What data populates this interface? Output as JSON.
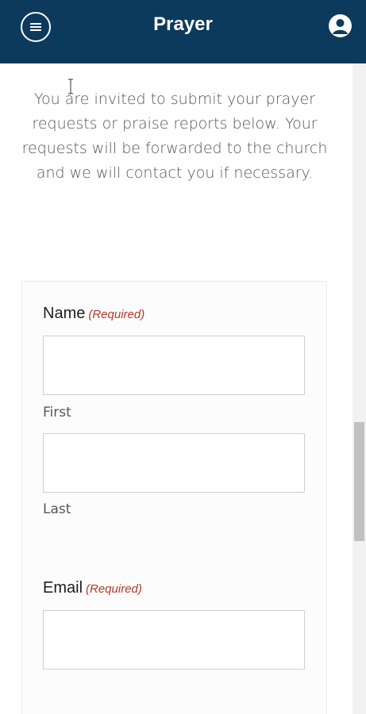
{
  "header": {
    "title": "Prayer",
    "menu_icon": "menu-icon",
    "account_icon": "account-circle-icon",
    "background": "#0b3a5c"
  },
  "intro": {
    "text": "You are invited to submit your prayer requests or praise reports below. Your requests will be forwarded to the church and we will contact you if necessary."
  },
  "form": {
    "name": {
      "label": "Name",
      "required": "(Required)",
      "first_label": "First",
      "last_label": "Last",
      "first_value": "",
      "last_value": ""
    },
    "email": {
      "label": "Email",
      "required": "(Required)",
      "value": ""
    }
  }
}
